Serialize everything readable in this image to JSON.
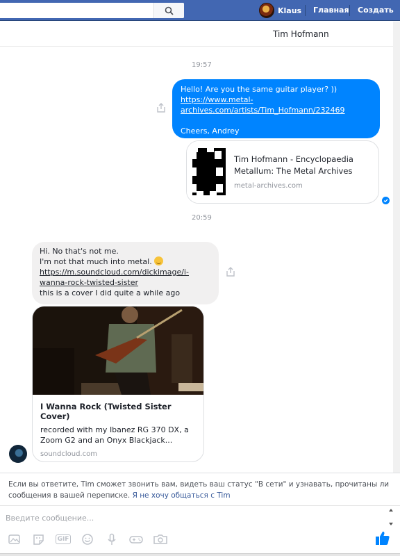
{
  "topbar": {
    "search_placeholder": "",
    "user_name": "Klaus",
    "home_label": "Главная",
    "create_label": "Создать"
  },
  "chat": {
    "contact_name": "Tim Hofmann"
  },
  "messages": {
    "time1": "19:57",
    "outgoing_line1": "Hello! Are you the same guitar player? ))",
    "outgoing_link_a": "https://www.metal-",
    "outgoing_link_b": "archives.com/artists/Tim_Hofmann/232469",
    "outgoing_signoff": "Cheers, Andrey",
    "card1_title": "Tim Hofmann - Encyclopaedia Metallum: The Metal Archives",
    "card1_domain": "metal-archives.com",
    "time2": "20:59",
    "incoming_line1": "Hi. No that's not me.",
    "incoming_line2": "I'm not that much into metal.",
    "incoming_link_a": "https://m.soundcloud.com/dickimage/i-",
    "incoming_link_b": "wanna-rock-twisted-sister",
    "incoming_line3": "this is a cover I did quite a while ago",
    "card2_title": "I Wanna Rock (Twisted Sister Cover)",
    "card2_desc": "recorded with my Ibanez RG 370 DX, a Zoom G2 and an Onyx Blackjack...",
    "card2_domain": "soundcloud.com"
  },
  "footer": {
    "notice_text": "Если вы ответите, Tim сможет звонить вам, видеть ваш статус \"В сети\" и узнавать, прочитаны ли сообщения в вашей переписке.",
    "notice_link": "Я не хочу общаться с Tim",
    "compose_placeholder": "Введите сообщение...",
    "gif_label": "GIF"
  },
  "colors": {
    "brand_blue": "#4267b2",
    "outgoing_bubble": "#0084ff",
    "incoming_bubble": "#f1f0f0",
    "link_blue": "#365899"
  },
  "icons": [
    "search-icon",
    "share-icon",
    "seen-check-icon",
    "image-icon",
    "sticker-icon",
    "gif-icon",
    "emoji-icon",
    "microphone-icon",
    "game-icon",
    "camera-icon",
    "like-icon"
  ]
}
